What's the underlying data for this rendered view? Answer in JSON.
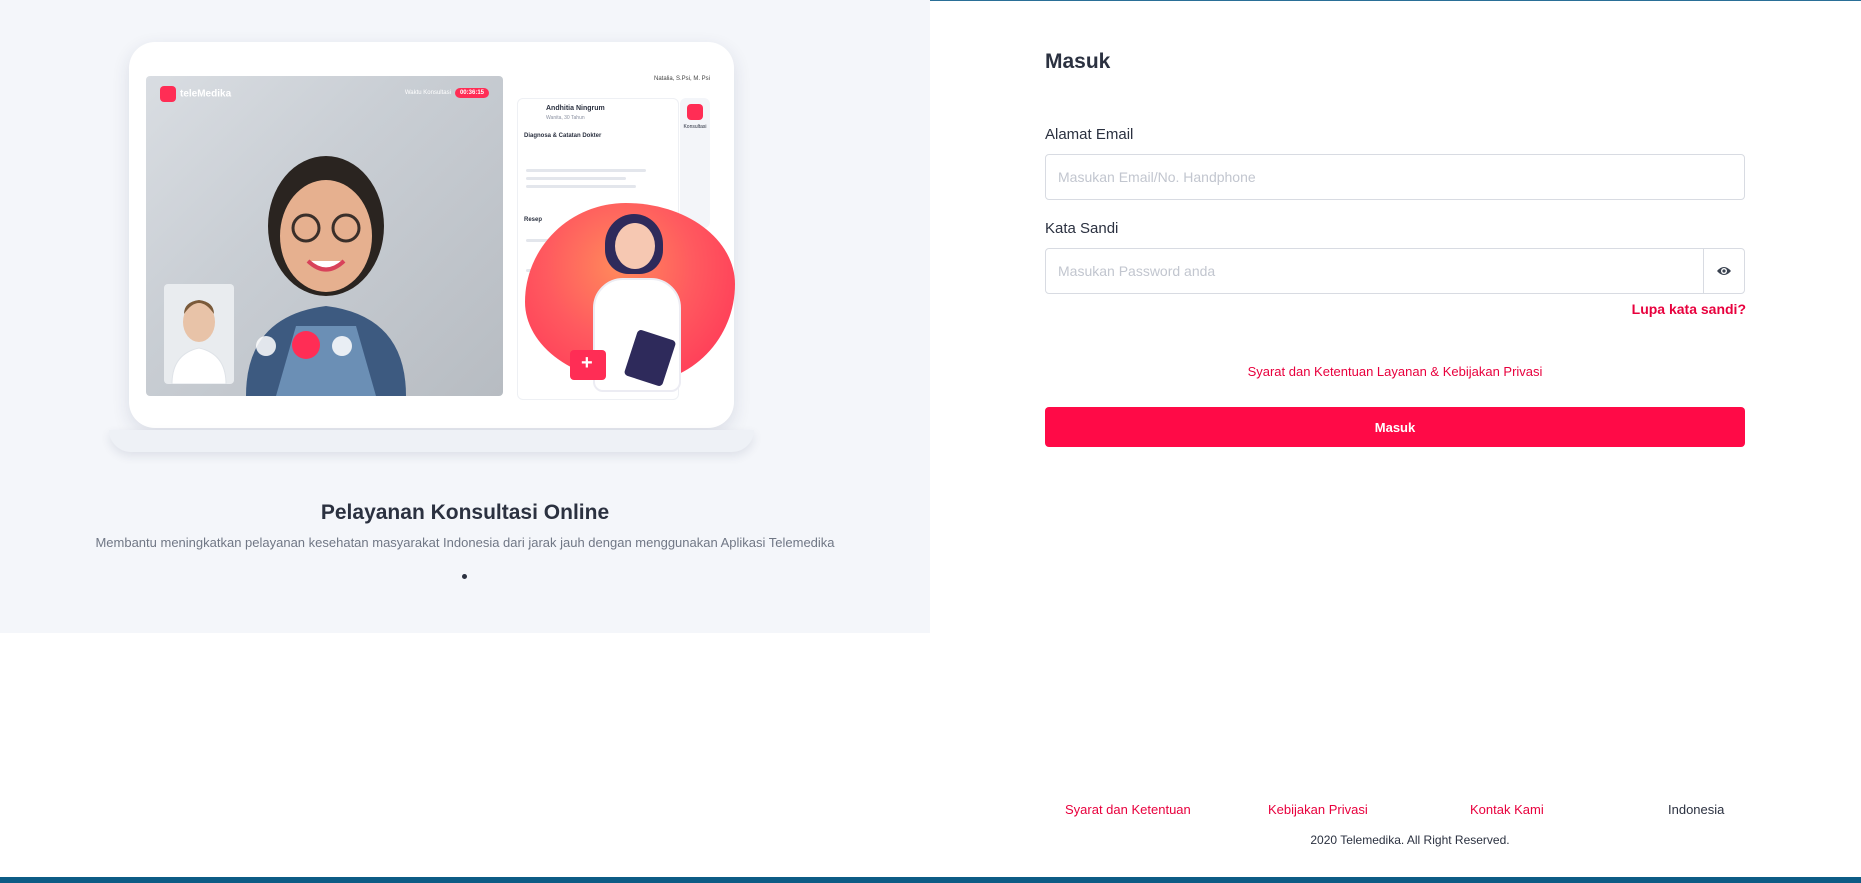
{
  "colors": {
    "accent": "#ff0a47",
    "link_red": "#e8003d",
    "left_panel_bg": "#f4f6fa",
    "text_dark": "#2b3140",
    "footer_bar": "#0d5c85"
  },
  "illustration": {
    "brand": "teleMedika",
    "call_timer_label": "Waktu Konsultasi",
    "call_timer": "00:36:15",
    "doctor_name": "Natalia, S.Psi, M. Psi",
    "patient_name": "Andhitia Ningrum",
    "patient_info": "Wanita, 30 Tahun",
    "section_diagnosis": "Diagnosa & Catatan Dokter",
    "section_recipe": "Resep",
    "side_label": "Konsultasi"
  },
  "slide": {
    "title": "Pelayanan Konsultasi Online",
    "description": "Membantu meningkatkan pelayanan kesehatan masyarakat Indonesia dari jarak jauh dengan menggunakan Aplikasi Telemedika",
    "dot_count": 1
  },
  "login": {
    "title": "Masuk",
    "email_label": "Alamat Email",
    "email_placeholder": "Masukan Email/No. Handphone",
    "email_value": "",
    "password_label": "Kata Sandi",
    "password_placeholder": "Masukan Password anda",
    "password_value": "",
    "show_password_icon": "eye-icon",
    "forgot_label": "Lupa kata sandi?",
    "terms_link": "Syarat dan Ketentuan Layanan & Kebijakan Privasi",
    "submit_label": "Masuk"
  },
  "footer": {
    "links": [
      "Syarat dan Ketentuan",
      "Kebijakan Privasi",
      "Kontak Kami"
    ],
    "language": "Indonesia",
    "copyright": "2020 Telemedika. All Right Reserved."
  }
}
